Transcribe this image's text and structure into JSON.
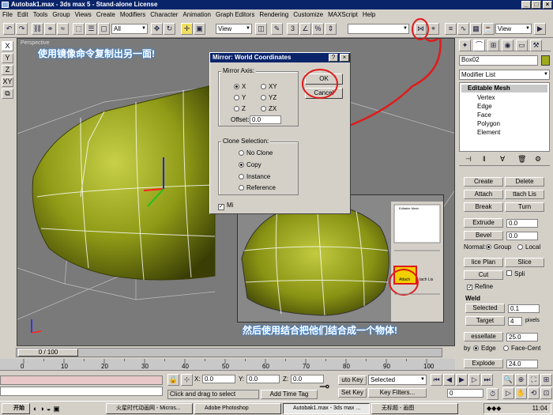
{
  "window": {
    "title": "Autobak1.max - 3ds max 5 - Stand-alone License",
    "min": "_",
    "max": "□",
    "close": "×"
  },
  "menu": [
    "File",
    "Edit",
    "Tools",
    "Group",
    "Views",
    "Create",
    "Modifiers",
    "Character",
    "Animation",
    "Graph Editors",
    "Rendering",
    "Customize",
    "MAXScript",
    "Help"
  ],
  "toolbar": {
    "selection_filter": "All",
    "ref_coord": "View",
    "ref_coord2": "View"
  },
  "axes": [
    "X",
    "Y",
    "Z",
    "XY",
    "⧉"
  ],
  "viewport": {
    "label": "Perspective",
    "note1": "使用镜像命令复制出另一面!",
    "note2": "然后使用结合把他们结合成一个物体!"
  },
  "mirror_dialog": {
    "title": "Mirror: World Coordinates",
    "help": "?",
    "close": "×",
    "axis_label": "Mirror Axis:",
    "axes": [
      "X",
      "Y",
      "Z",
      "XY",
      "YZ",
      "ZX"
    ],
    "offset_label": "Offset:",
    "offset_value": "0.0",
    "ok": "OK",
    "cancel": "Cancel",
    "clone_label": "Clone Selection:",
    "clone_options": [
      "No Clone",
      "Copy",
      "Instance",
      "Reference"
    ],
    "mirror_ik": "Mi"
  },
  "inset": {
    "mini_labels": [
      "Attach",
      "tach Lis",
      "Editable Mesh"
    ]
  },
  "right_panel": {
    "object_name": "Box02",
    "modifier_list": "Modifier List",
    "stack_root": "Editable Mesh",
    "stack_items": [
      "Vertex",
      "Edge",
      "Face",
      "Polygon",
      "Element"
    ],
    "buttons": {
      "create": "Create",
      "delete": "Delete",
      "attach": "Attach",
      "attach_list": "ttach Lis",
      "break": "Break",
      "turn": "Turn",
      "extrude": "Extrude",
      "extrude_val": "0.0",
      "bevel": "Bevel",
      "bevel_val": "0.0",
      "normal": "Normal:",
      "group": "Group",
      "local": "Local",
      "slice_plane": "lice Plan",
      "slice": "Slice",
      "cut": "Cut",
      "split": "Spli",
      "refine": "Refine",
      "weld": "Weld",
      "selected": "Selected",
      "selected_val": "0.1",
      "target": "Target",
      "target_val": "4",
      "pixels": "pixels",
      "tessellate": "essellate",
      "tess_val": "25.0",
      "by": "by",
      "edge": "Edge",
      "face_center": "Face-Cent",
      "explode": "Explode",
      "explode_val": "24.0"
    }
  },
  "timeline": {
    "counter": "0 / 100",
    "ticks": [
      "0",
      "10",
      "20",
      "30",
      "40",
      "50",
      "60",
      "70",
      "80",
      "90",
      "100"
    ]
  },
  "status": {
    "x_label": "X:",
    "x": "0.0",
    "y_label": "Y:",
    "y": "0.0",
    "z_label": "Z:",
    "z": "0.0",
    "prompt": "Click and drag to select",
    "add_time_tag": "Add Time Tag",
    "auto_key": "uto Key",
    "selected": "Selected",
    "set_key": "Set Key",
    "key_filters": "Key Filters...",
    "frame": "0"
  },
  "taskbar": {
    "start": "开始",
    "tasks": [
      "火星时代动画网 - Micros...",
      "Adobe Photoshop",
      "Autobak1.max - 3ds max ...",
      "无标题 - 画图"
    ],
    "time": "11:04"
  },
  "colors": {
    "title": "#0a246a",
    "object": "#9fa91e",
    "annotation": "#e01a1a"
  }
}
